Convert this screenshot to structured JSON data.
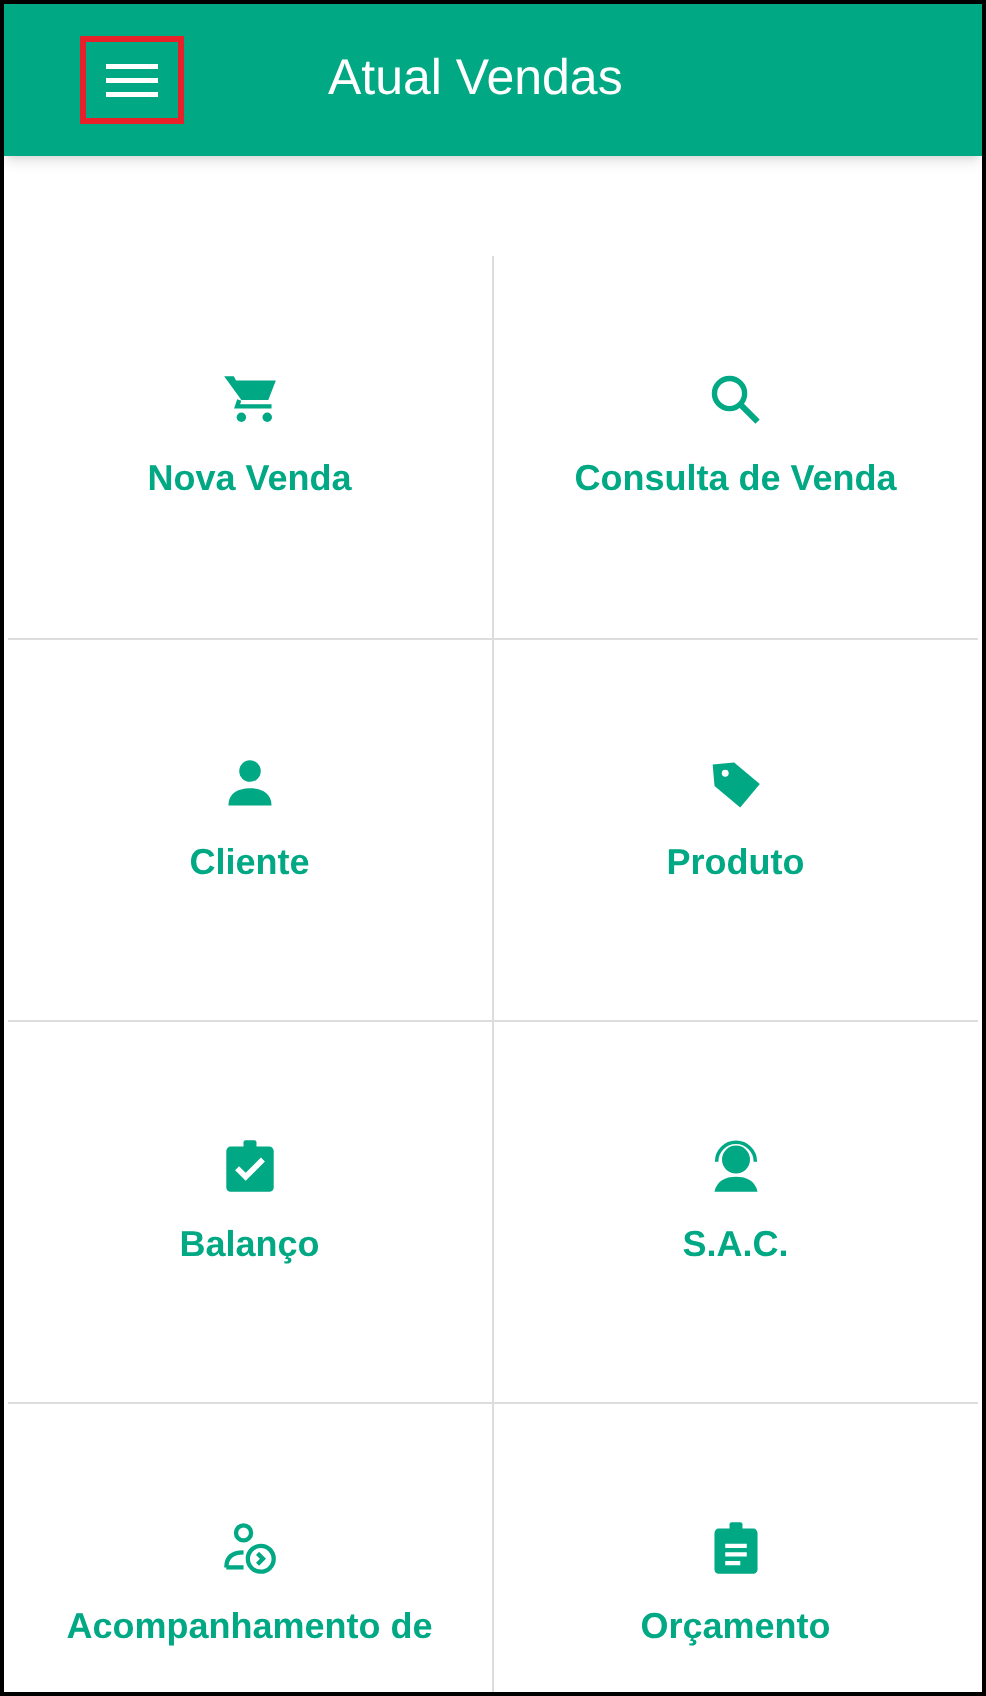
{
  "app_bar": {
    "title": "Atual Vendas",
    "menu_highlighted": true
  },
  "tiles": [
    {
      "kind": "cart",
      "label": "Nova Venda"
    },
    {
      "kind": "search",
      "label": "Consulta de Venda"
    },
    {
      "kind": "person",
      "label": "Cliente"
    },
    {
      "kind": "tag",
      "label": "Produto"
    },
    {
      "kind": "clipboard-check",
      "label": "Balanço"
    },
    {
      "kind": "headset",
      "label": "S.A.C."
    },
    {
      "kind": "person-arrow",
      "label": "Acompanhamento de"
    },
    {
      "kind": "clipboard-list",
      "label": "Orçamento"
    }
  ]
}
